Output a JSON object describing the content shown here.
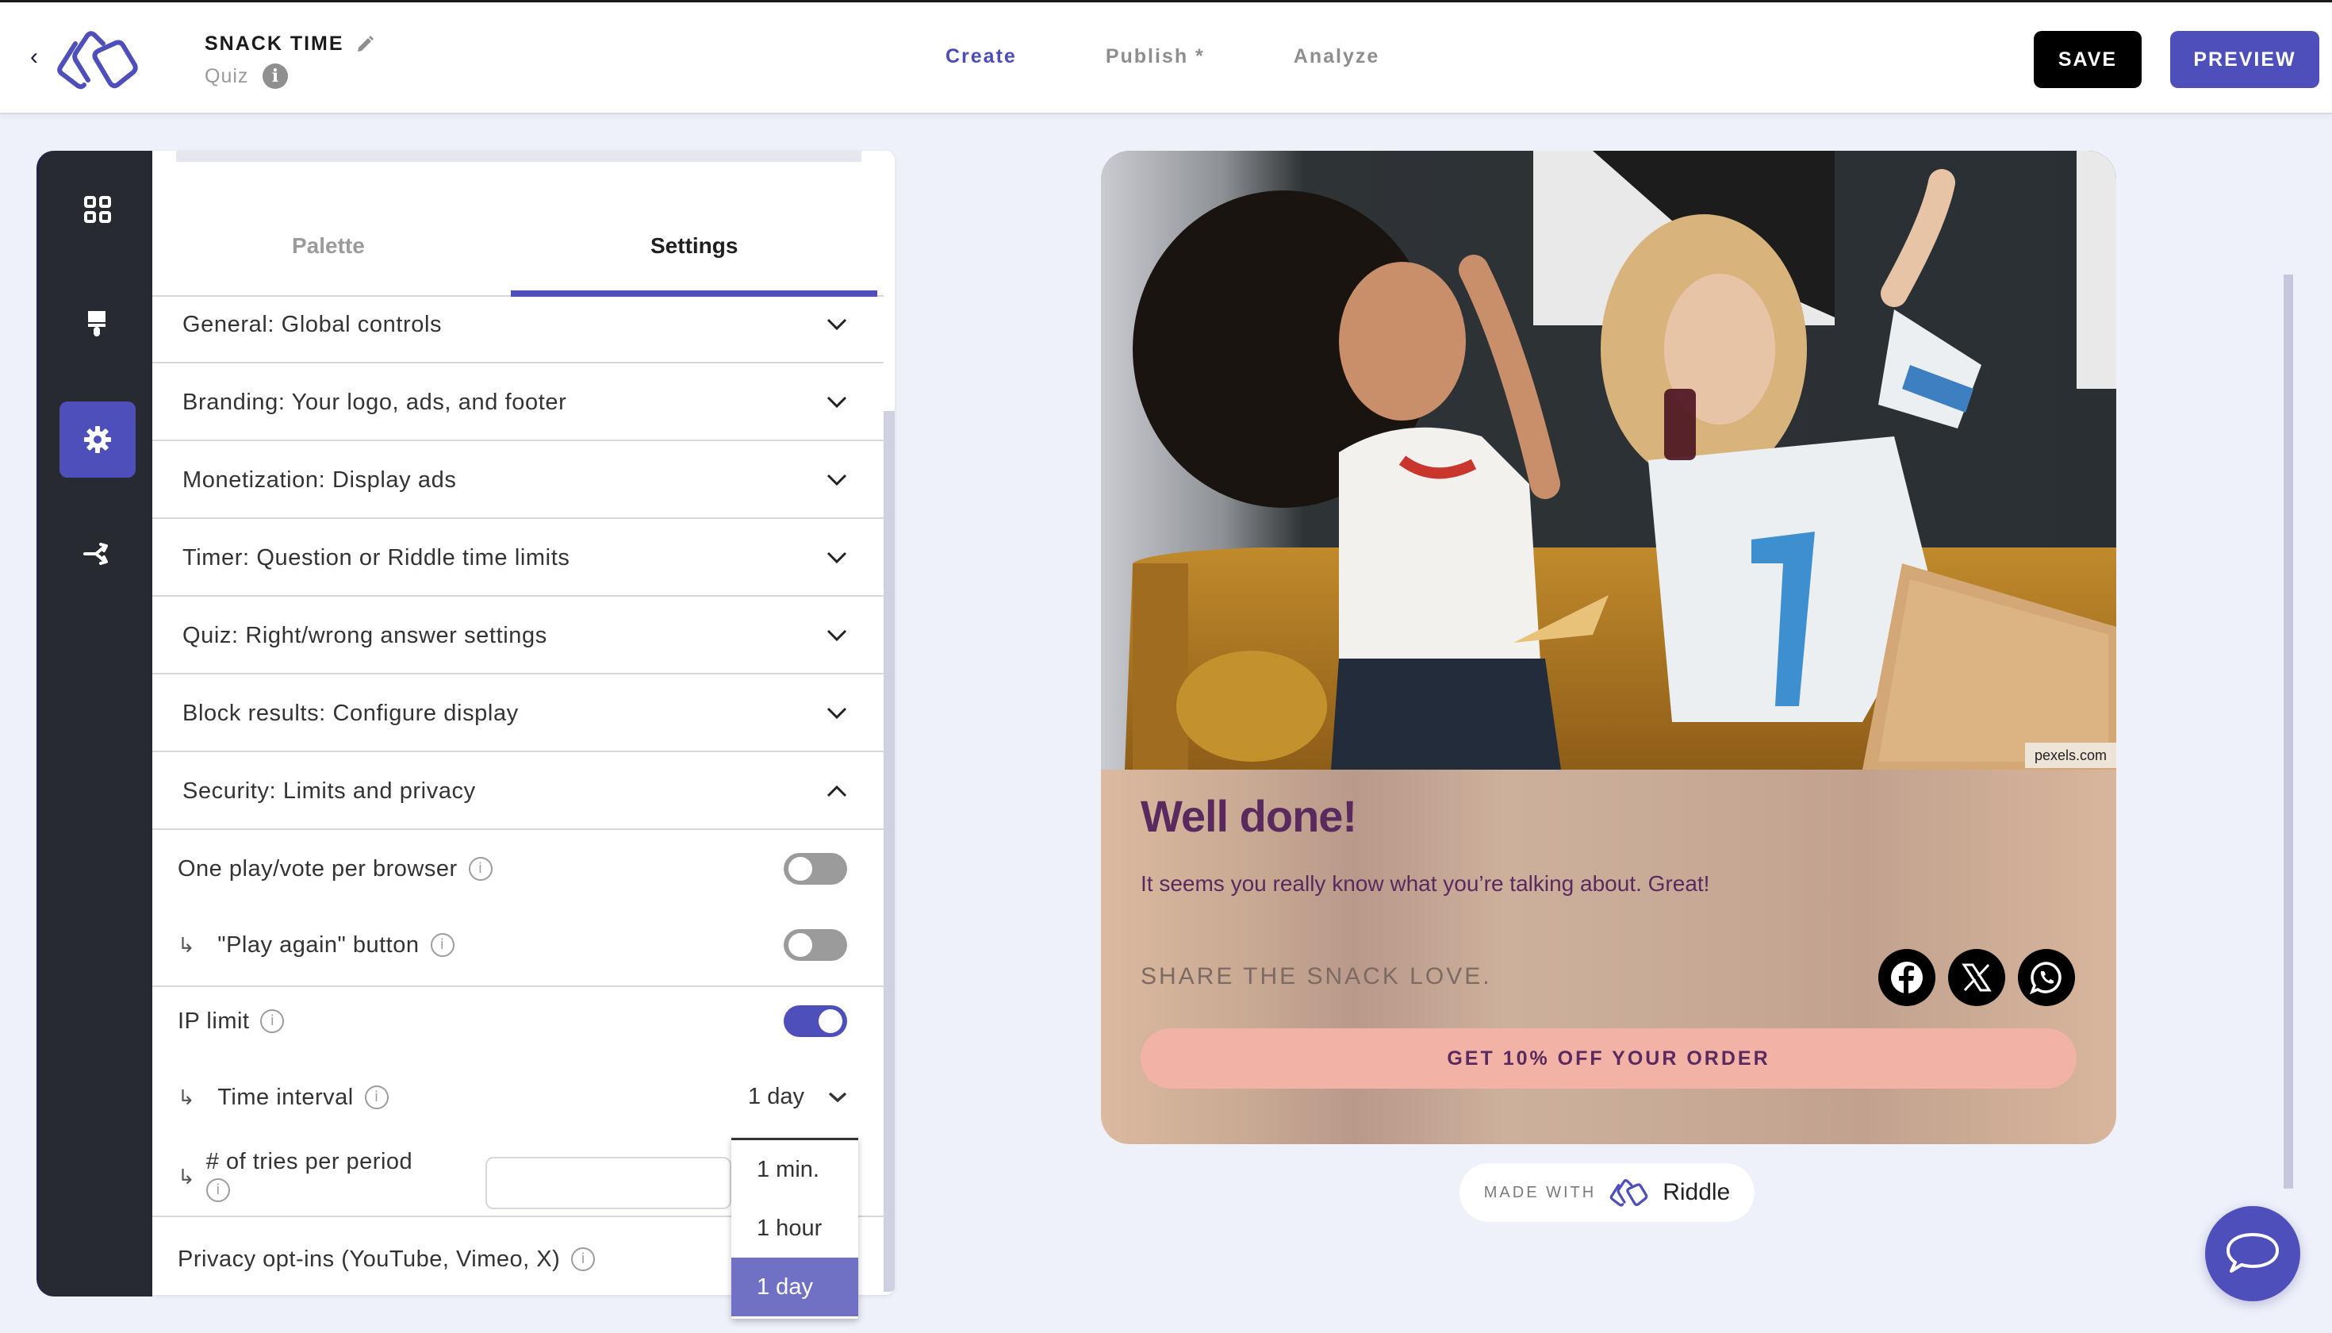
{
  "header": {
    "back_icon": "chevron-left-icon",
    "logo": "riddle-logo",
    "title": "SNACK TIME",
    "edit_icon": "pencil-icon",
    "subtitle": "Quiz",
    "info_icon": "info-icon",
    "nav": [
      {
        "label": "Create",
        "active": true
      },
      {
        "label": "Publish *",
        "active": false
      },
      {
        "label": "Analyze",
        "active": false
      }
    ],
    "save_label": "SAVE",
    "preview_label": "PREVIEW"
  },
  "rail": {
    "items": [
      {
        "name": "blocks",
        "icon": "grid-icon",
        "active": false
      },
      {
        "name": "design",
        "icon": "paintbrush-icon",
        "active": false
      },
      {
        "name": "settings",
        "icon": "gear-icon",
        "active": true
      },
      {
        "name": "logic",
        "icon": "branch-icon",
        "active": false
      }
    ]
  },
  "panel": {
    "tabs": [
      {
        "label": "Palette",
        "active": false
      },
      {
        "label": "Settings",
        "active": true
      }
    ],
    "sections": [
      {
        "label": "General: Global controls",
        "expanded": false
      },
      {
        "label": "Branding: Your logo, ads, and footer",
        "expanded": false
      },
      {
        "label": "Monetization: Display ads",
        "expanded": false
      },
      {
        "label": "Timer: Question or Riddle time limits",
        "expanded": false
      },
      {
        "label": "Quiz: Right/wrong answer settings",
        "expanded": false
      },
      {
        "label": "Block results: Configure display",
        "expanded": false
      },
      {
        "label": "Security: Limits and privacy",
        "expanded": true
      }
    ],
    "security": {
      "one_play_label": "One play/vote per browser",
      "one_play_on": false,
      "play_again_label": "\"Play again\" button",
      "play_again_on": false,
      "ip_limit_label": "IP limit",
      "ip_limit_on": true,
      "time_interval_label": "Time interval",
      "time_interval_value": "1 day",
      "tries_label": "# of tries per period",
      "tries_value": "",
      "privacy_label": "Privacy opt-ins (YouTube, Vimeo, X)",
      "sub_arrow": "↳"
    },
    "dropdown": {
      "options": [
        "1 min.",
        "1 hour",
        "1 day"
      ],
      "selected": "1 day"
    }
  },
  "preview": {
    "photo_credit": "pexels.com",
    "title": "Well done!",
    "text": "It seems you really know what you’re talking about. Great!",
    "share_label": "SHARE THE SNACK LOVE.",
    "share_icons": [
      "facebook-icon",
      "x-icon",
      "whatsapp-icon"
    ],
    "cta_label": "GET 10% OFF YOUR ORDER",
    "made_with_label": "MADE WITH",
    "made_with_brand": "Riddle"
  },
  "colors": {
    "accent": "#4f4fbb",
    "rail_bg": "#282a31",
    "page_bg": "#eef0fa",
    "card_title": "#5a2a5e",
    "cta_bg": "#f2b3a6",
    "dropdown_selected": "#7070c4"
  }
}
